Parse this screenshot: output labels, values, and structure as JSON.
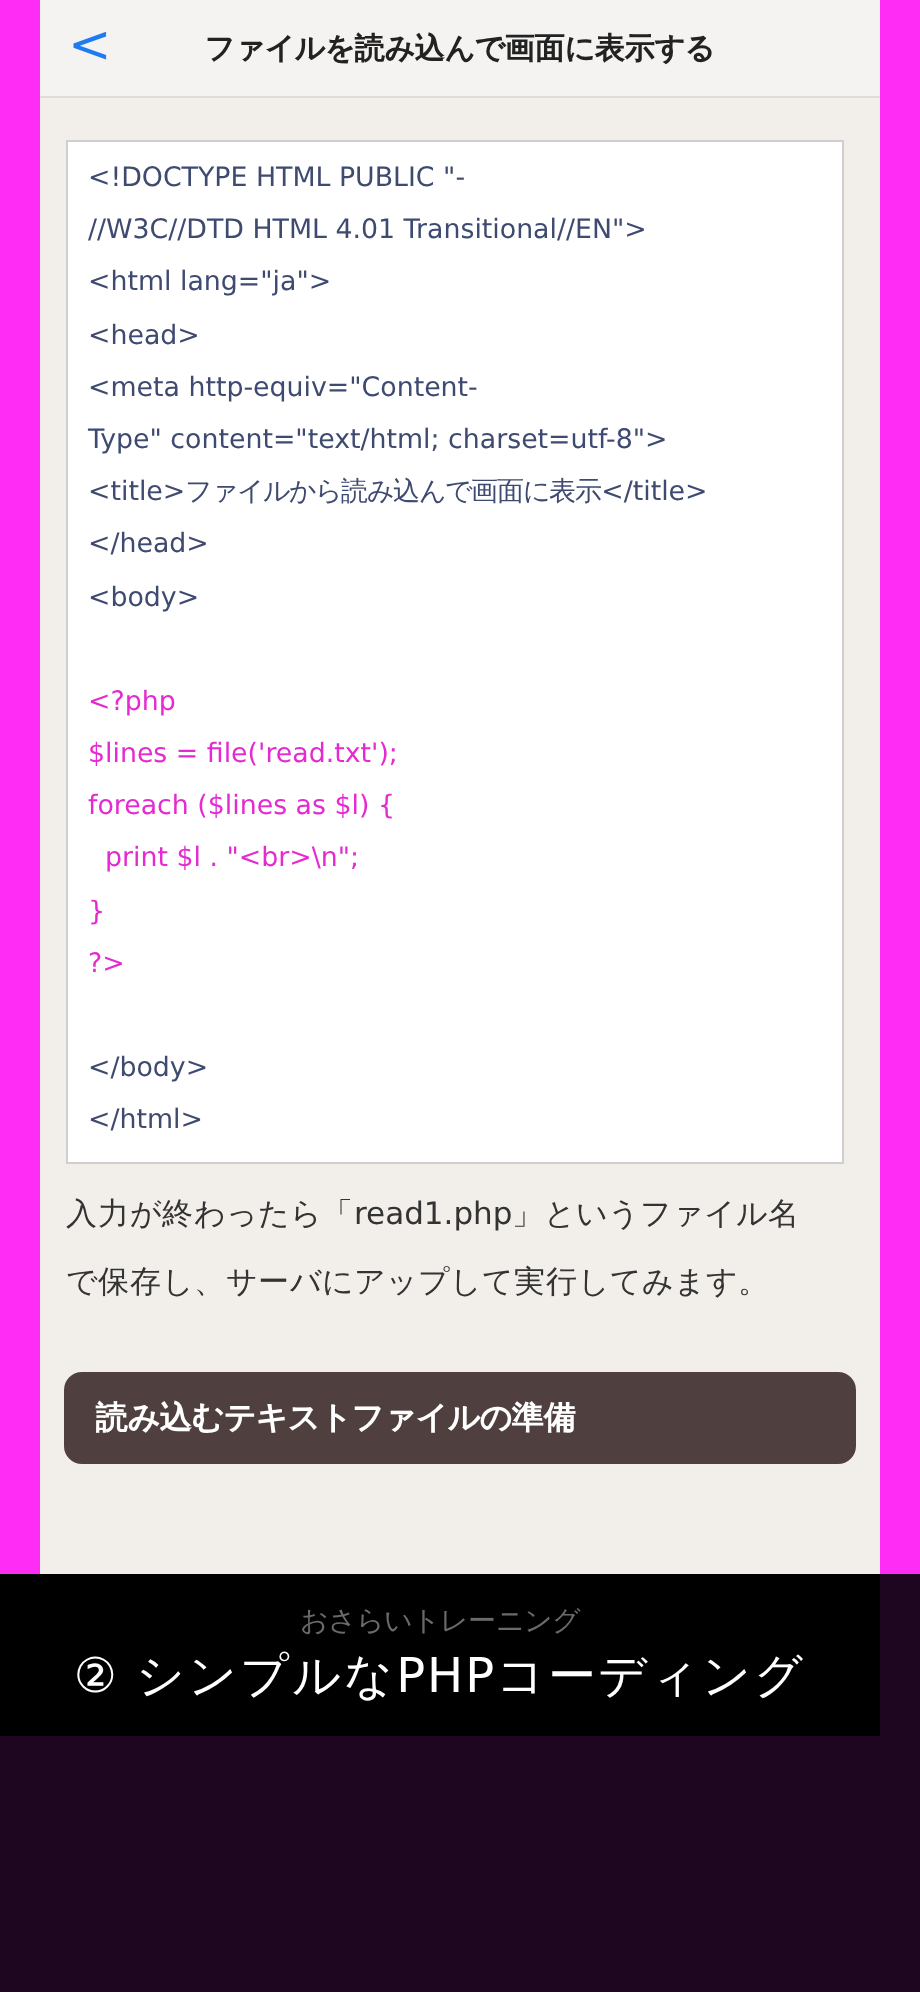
{
  "header": {
    "back_glyph": "<",
    "title": "ファイルを読み込んで画面に表示する"
  },
  "code": [
    {
      "kind": "html",
      "text": "<!DOCTYPE HTML PUBLIC \"-"
    },
    {
      "kind": "html",
      "text": "//W3C//DTD HTML 4.01 Transitional//EN\">"
    },
    {
      "kind": "html",
      "text": "<html lang=\"ja\">"
    },
    {
      "kind": "html",
      "text": "<head>"
    },
    {
      "kind": "html",
      "text": "<meta http-equiv=\"Content-"
    },
    {
      "kind": "html",
      "text": "Type\" content=\"text/html; charset=utf-8\">"
    },
    {
      "kind": "html",
      "text": "<title>ファイルから読み込んで画面に表示</title>"
    },
    {
      "kind": "html",
      "text": "</head>"
    },
    {
      "kind": "html",
      "text": "<body>"
    },
    {
      "kind": "blank"
    },
    {
      "kind": "php",
      "text": "<?php"
    },
    {
      "kind": "php",
      "text": "$lines = file('read.txt');"
    },
    {
      "kind": "php",
      "text": "foreach ($lines as $l) {"
    },
    {
      "kind": "php",
      "text": "  print $l . \"<br>\\n\";"
    },
    {
      "kind": "php",
      "text": "}"
    },
    {
      "kind": "php",
      "text": "?>"
    },
    {
      "kind": "blank"
    },
    {
      "kind": "html",
      "text": "</body>"
    },
    {
      "kind": "html",
      "text": "</html>"
    }
  ],
  "paragraph": "入力が終わったら「read1.php」というファイル名で保存し、サーバにアップして実行してみます。",
  "section_button": "読み込むテキストファイルの準備",
  "next_section": "おさらいトレーニング",
  "caption": "② シンプルなPHPコーディング"
}
